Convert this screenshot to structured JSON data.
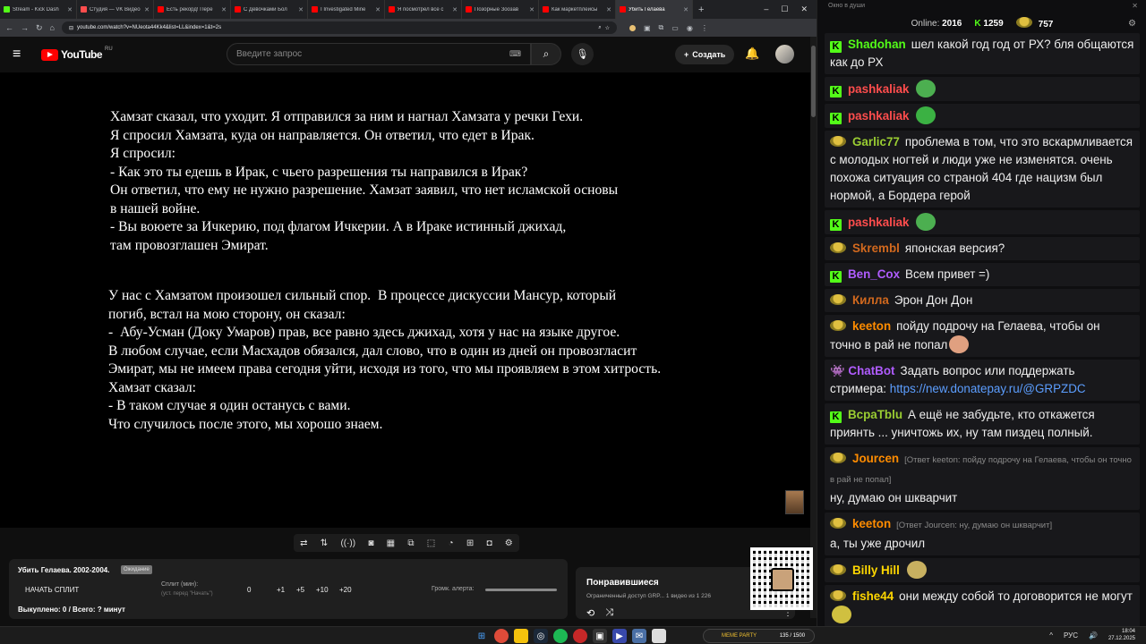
{
  "browser": {
    "tabs": [
      {
        "title": "Stream - Kick Dash",
        "color": "#53fc18"
      },
      {
        "title": "Студия — VK Видео",
        "color": "#ff4d4d"
      },
      {
        "title": "Есть рекорд! Пере",
        "color": "#ff0000"
      },
      {
        "title": "С Девочками Бол",
        "color": "#ff0000"
      },
      {
        "title": "I Investigated Mine",
        "color": "#ff0000"
      },
      {
        "title": "Я посмотрел все с",
        "color": "#ff0000"
      },
      {
        "title": "Позорные Зоозав",
        "color": "#ff0000"
      },
      {
        "title": "Как маркетплейсы",
        "color": "#ff0000"
      },
      {
        "title": "Убить Гелаева",
        "color": "#ff0000",
        "active": true
      }
    ],
    "url": "youtube.com/watch?v=NUeota44Kk4&list=LL&index=1&t=2s"
  },
  "youtube": {
    "logo_word": "YouTube",
    "logo_region": "RU",
    "search_placeholder": "Введите запрос",
    "create_label": "Создать"
  },
  "video_text": {
    "block1": "Хамзат сказал, что уходит. Я отправился за ним и нагнал Хамзата у речки Гехи.\nЯ спросил Хамзата, куда он направляется. Он ответил, что едет в Ирак.\nЯ спросил:\n- Как это ты едешь в Ирак, с чьего разрешения ты направился в Ирак?\nОн ответил, что ему не нужно разрешение. Хамзат заявил, что нет исламской основы\nв нашей войне.\n- Вы воюете за Ичкерию, под флагом Ичкерии. А в Ираке истинный джихад,\nтам провозглашен Эмират.",
    "block2": "У нас с Хамзатом произошел сильный спор.  В процессе дискуссии Мансур, который\nпогиб, встал на мою сторону, он сказал:\n-  Абу-Усман (Доку Умаров) прав, все равно здесь джихад, хотя у нас на языке другое.\nВ любом случае, если Масхадов обязался, дал слово, что в один из дней он провозгласит\nЭмират, мы не имеем права сегодня уйти, исходя из того, что мы проявляем в этом хитрость.\nХамзат сказал:\n- В таком случае я один останусь с вами.\nЧто случилось после этого, мы хорошо знаем."
  },
  "split_panel": {
    "title": "Убить Гелаева. 2002-2004.",
    "badge": "Ожидание",
    "start_label": "НАЧАТЬ СПЛИТ",
    "split_label": "Сплит (мин):",
    "split_hint": "(уст. перед \"Начать\")",
    "current_value": "0",
    "increments": [
      "+1",
      "+5",
      "+10",
      "+20"
    ],
    "alert_label": "Громк. алерта:",
    "footer": "Выкуплено: 0 / Всего: ? минут"
  },
  "playlist": {
    "title": "Понравившиеся",
    "subtitle": "Ограниченный доступ GRP...   1 видео из 1 226"
  },
  "chat": {
    "window_title": "Окно в души",
    "online_label": "Online:",
    "online_count": "2016",
    "kick_count": "1259",
    "other_count": "757",
    "messages": [
      {
        "user": "Shadohan",
        "badge": "kick",
        "color": "#53fc18",
        "text": "шел какой год год от РХ? бля общаются как до РХ"
      },
      {
        "user": "pashkaliak",
        "badge": "kick",
        "color": "#ff4d4d",
        "text": "",
        "emote": "#4caf50"
      },
      {
        "user": "pashkaliak",
        "badge": "kick",
        "color": "#ff4d4d",
        "text": "",
        "emote": "#3bb143"
      },
      {
        "user": "Garlic77",
        "badge": "pepe",
        "color": "#9acd32",
        "text": "проблема в том, что это вскармливается с молодых ногтей и люди уже не изменятся. очень похожа ситуация со страной 404 где нацизм был нормой, а Бордера герой"
      },
      {
        "user": "pashkaliak",
        "badge": "kick",
        "color": "#ff4d4d",
        "text": "",
        "emote": "#4caf50"
      },
      {
        "user": "Skrembl",
        "badge": "pepe",
        "color": "#d2691e",
        "text": "японская версия?"
      },
      {
        "user": "Ben_Cox",
        "badge": "kick",
        "color": "#b05cff",
        "text": "Всем привет =)"
      },
      {
        "user": "Килла",
        "badge": "pepe",
        "color": "#d2691e",
        "text": "Эрон Дон Дон"
      },
      {
        "user": "keeton",
        "badge": "pepe",
        "color": "#ff8c00",
        "text": "пойду подрочу на Гелаева, чтобы он точно в рай не попал",
        "emote": "#e0a080"
      },
      {
        "user": "ChatBot",
        "badge": "bot",
        "color": "#b05cff",
        "text": "Задать вопрос или поддержать стримера:",
        "link": "https://new.donatepay.ru/@GRPZDC"
      },
      {
        "user": "BcpaTblu",
        "badge": "kick",
        "color": "#9acd32",
        "text": "А ещё не забудьте, кто откажется приянть ... уничтожь их, ну там пиздец полный."
      },
      {
        "user": "Jourcen",
        "badge": "pepe",
        "color": "#ff8c00",
        "reply": "[Ответ keeton: пойду подрочу на Гелаева, чтобы он точно в рай не попал]",
        "text": "ну, думаю он шкварчит"
      },
      {
        "user": "keeton",
        "badge": "pepe",
        "color": "#ff8c00",
        "reply": "[Ответ Jourcen: ну, думаю он шкварчит]",
        "text": "а, ты уже дрочил"
      },
      {
        "user": "Billy Hill",
        "badge": "pepe",
        "color": "#ffd700",
        "text": "",
        "emote": "#c8b060"
      },
      {
        "user": "fishe44",
        "badge": "pepe",
        "color": "#ffd700",
        "text": "они между собой то договорится не могут",
        "emote": "#d0c040"
      }
    ]
  },
  "taskbar": {
    "meme_label": "MEME PARTY",
    "meme_count": "135 / 1500",
    "lang": "РУС",
    "time": "18:04",
    "date": "27.12.2025"
  }
}
